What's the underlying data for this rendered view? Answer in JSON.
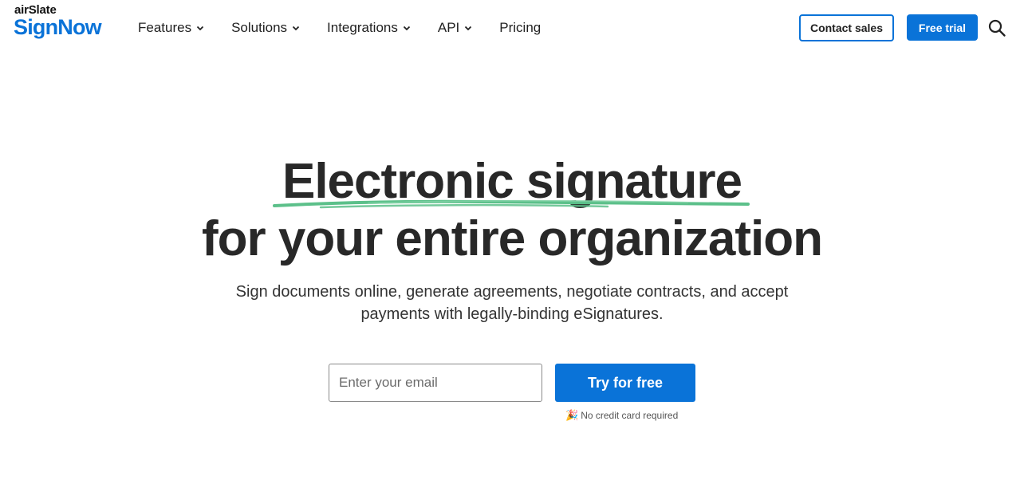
{
  "brand": {
    "top_text": "airSlate",
    "main_text": "SignNow",
    "color": "#0a73d8"
  },
  "nav": {
    "items": [
      {
        "label": "Features",
        "has_dropdown": true
      },
      {
        "label": "Solutions",
        "has_dropdown": true
      },
      {
        "label": "Integrations",
        "has_dropdown": true
      },
      {
        "label": "API",
        "has_dropdown": true
      },
      {
        "label": "Pricing",
        "has_dropdown": false
      }
    ],
    "contact_label": "Contact sales",
    "trial_label": "Free trial",
    "search_icon": "search-icon"
  },
  "hero": {
    "title_line1": "Electronic signature",
    "title_line2": "for your entire organization",
    "underline_color": "#5cc08a",
    "subtitle_line1": "Sign documents online, generate agreements, negotiate contracts, and accept",
    "subtitle_line2": "payments with legally-binding eSignatures.",
    "email_placeholder": "Enter your email",
    "email_value": "",
    "cta_label": "Try for free",
    "note_icon": "party-popper-icon",
    "note_text": "No credit card required"
  },
  "colors": {
    "accent": "#0a73d8",
    "text": "#282828"
  }
}
